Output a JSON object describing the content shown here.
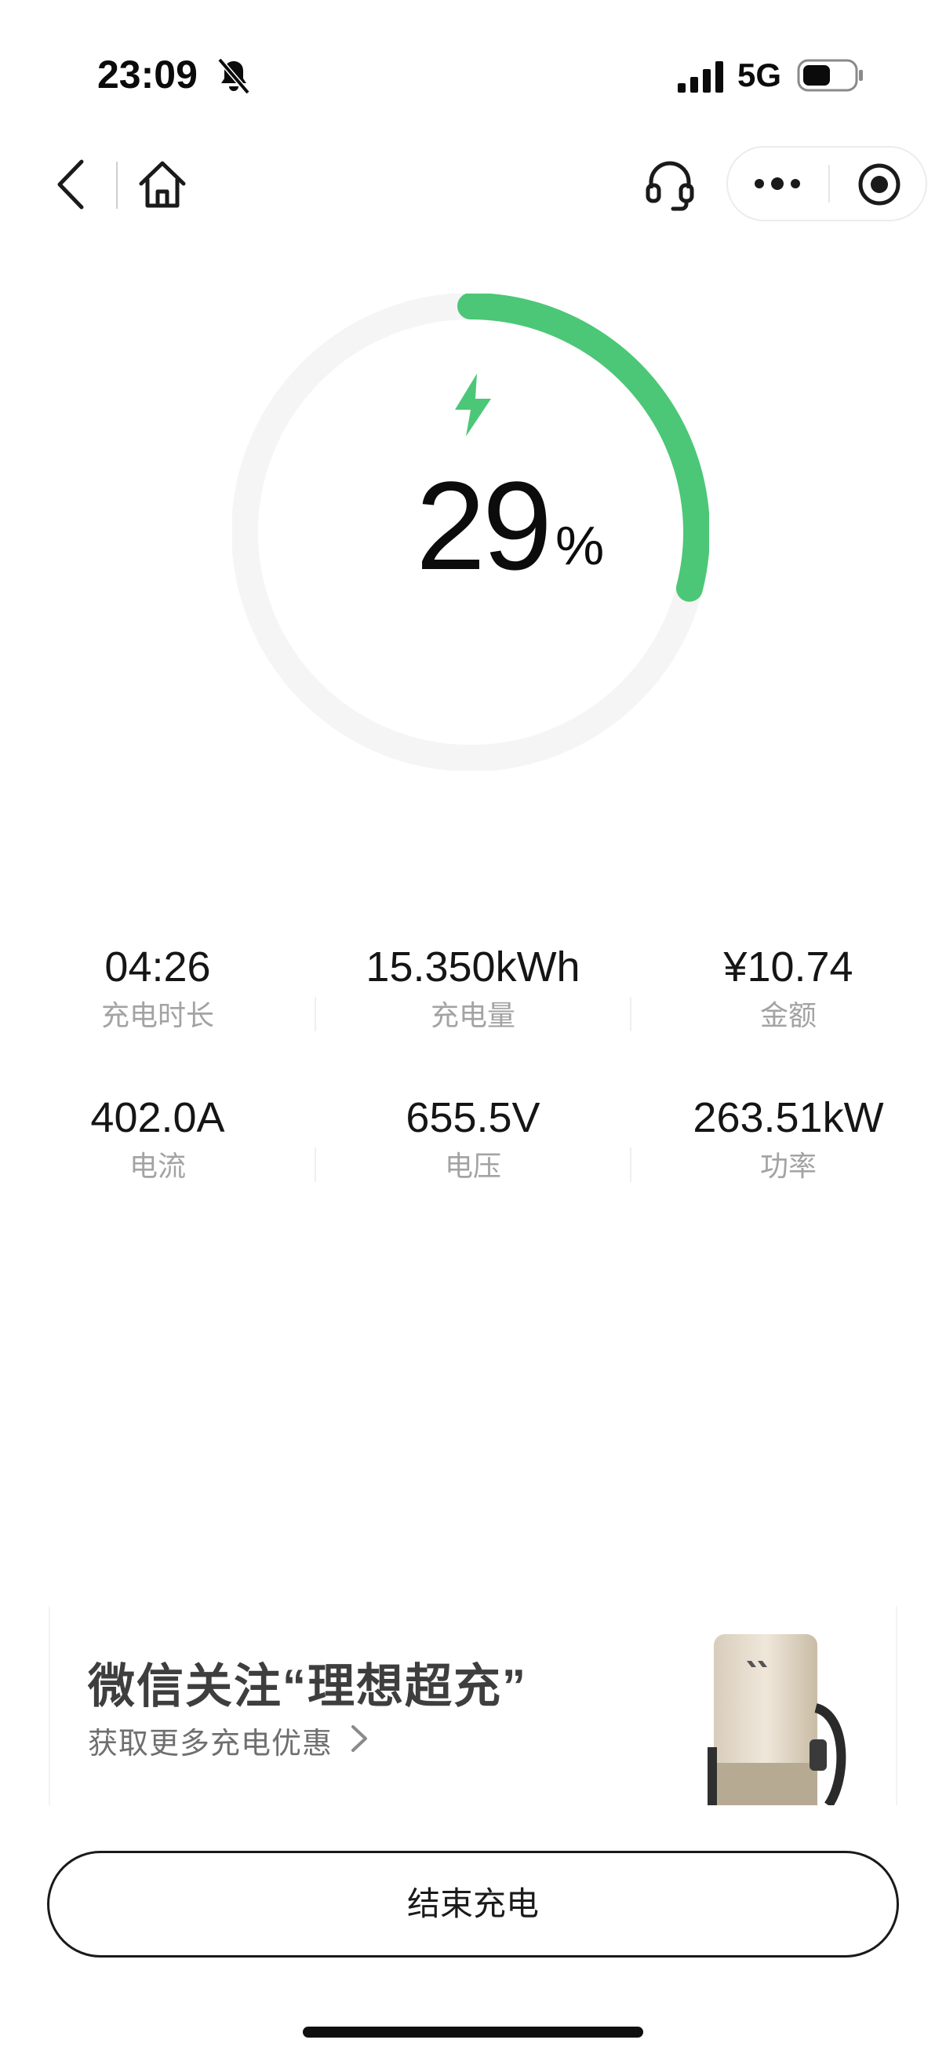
{
  "status_bar": {
    "time": "23:09",
    "network": "5G",
    "icons": [
      "bell-slash-icon",
      "signal-icon",
      "battery-icon"
    ]
  },
  "nav": {
    "icons": [
      "chevron-left-icon",
      "home-icon",
      "headset-icon",
      "more-dots-icon",
      "close-target-icon"
    ]
  },
  "charge": {
    "percent": "29",
    "percent_sign": "%",
    "progress_fraction": 0.29,
    "accent_color": "#4cc777",
    "track_color": "#f5f5f5"
  },
  "stats": [
    {
      "value": "04:26",
      "label": "充电时长"
    },
    {
      "value": "15.350kWh",
      "label": "充电量"
    },
    {
      "value": "¥10.74",
      "label": "金额"
    },
    {
      "value": "402.0A",
      "label": "电流"
    },
    {
      "value": "655.5V",
      "label": "电压"
    },
    {
      "value": "263.51kW",
      "label": "功率"
    }
  ],
  "banner": {
    "title": "微信关注“理想超充”",
    "subtitle": "获取更多充电优惠"
  },
  "actions": {
    "end_charge_label": "结束充电"
  }
}
